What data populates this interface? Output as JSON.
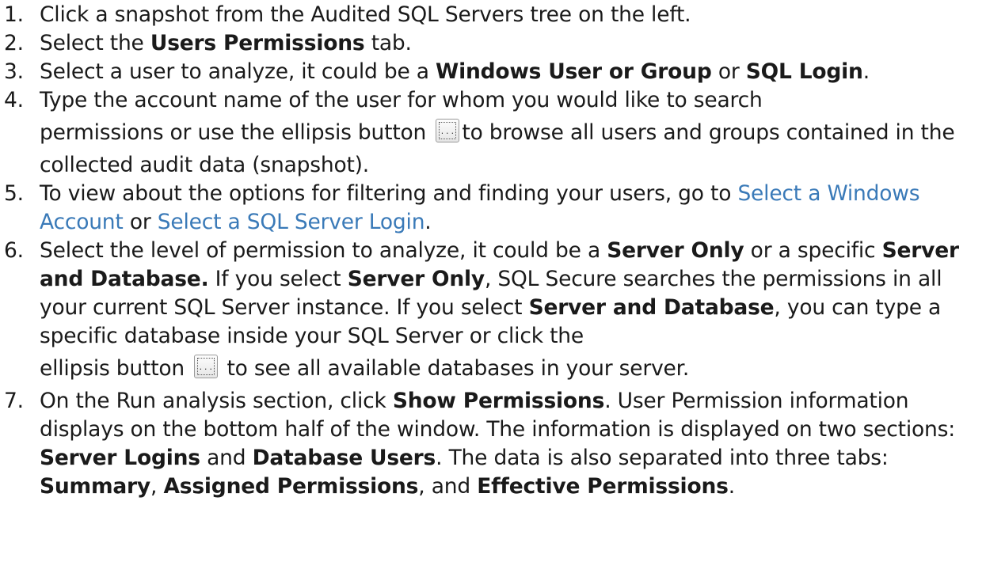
{
  "steps": [
    {
      "number": "1.",
      "text": "Click a snapshot from the Audited SQL Servers tree on the left."
    },
    {
      "number": "2.",
      "pre": "Select the ",
      "bold": "Users Permissions",
      "post": " tab."
    },
    {
      "number": "3.",
      "pre": "Select a user to analyze, it could be a ",
      "bold1": "Windows User or Group",
      "mid": " or ",
      "bold2": "SQL Login",
      "post": "."
    },
    {
      "number": "4.",
      "line1": "Type the account name of the user for whom you would like to search",
      "pre_button": "permissions or use the ellipsis button",
      "post_button": "to browse all users and groups contained in the collected audit data (snapshot)."
    },
    {
      "number": "5.",
      "pre": "To view about the options for filtering and finding your users, go to ",
      "link1": "Select a Windows Account",
      "mid": " or ",
      "link2": "Select a SQL Server Login",
      "post": "."
    },
    {
      "number": "6.",
      "t1": "Select the level of permission to analyze, it could be a ",
      "b1": "Server Only",
      "t2": " or a specific ",
      "b2": "Server and Database.",
      "t3": " If you select ",
      "b3": "Server Only",
      "t4": ", SQL Secure searches the permissions in all your current SQL Server instance. If you select ",
      "b4": "Server and Database",
      "t5": ", you can type a specific database inside your SQL Server or click the",
      "pre_button": "ellipsis button",
      "post_button": " to see all available databases in your server."
    },
    {
      "number": "7.",
      "t1": "On the Run analysis section, click ",
      "b1": "Show Permissions",
      "t2": ". User Permission information displays on the bottom half of the window. The information is displayed on two sections: ",
      "b2": "Server Logins",
      "t3": " and ",
      "b3": "Database Users",
      "t4": ". The data is also separated into three tabs: ",
      "b4": "Summary",
      "t5": ", ",
      "b5": "Assigned Permissions",
      "t6": ", and ",
      "b6": "Effective Permissions",
      "t7": "."
    }
  ],
  "icons": {
    "ellipsis_button": "ellipsis-button-icon",
    "ellipsis_dots": "..."
  },
  "colors": {
    "link": "#3a7ab8",
    "text": "#1a1a1a"
  }
}
